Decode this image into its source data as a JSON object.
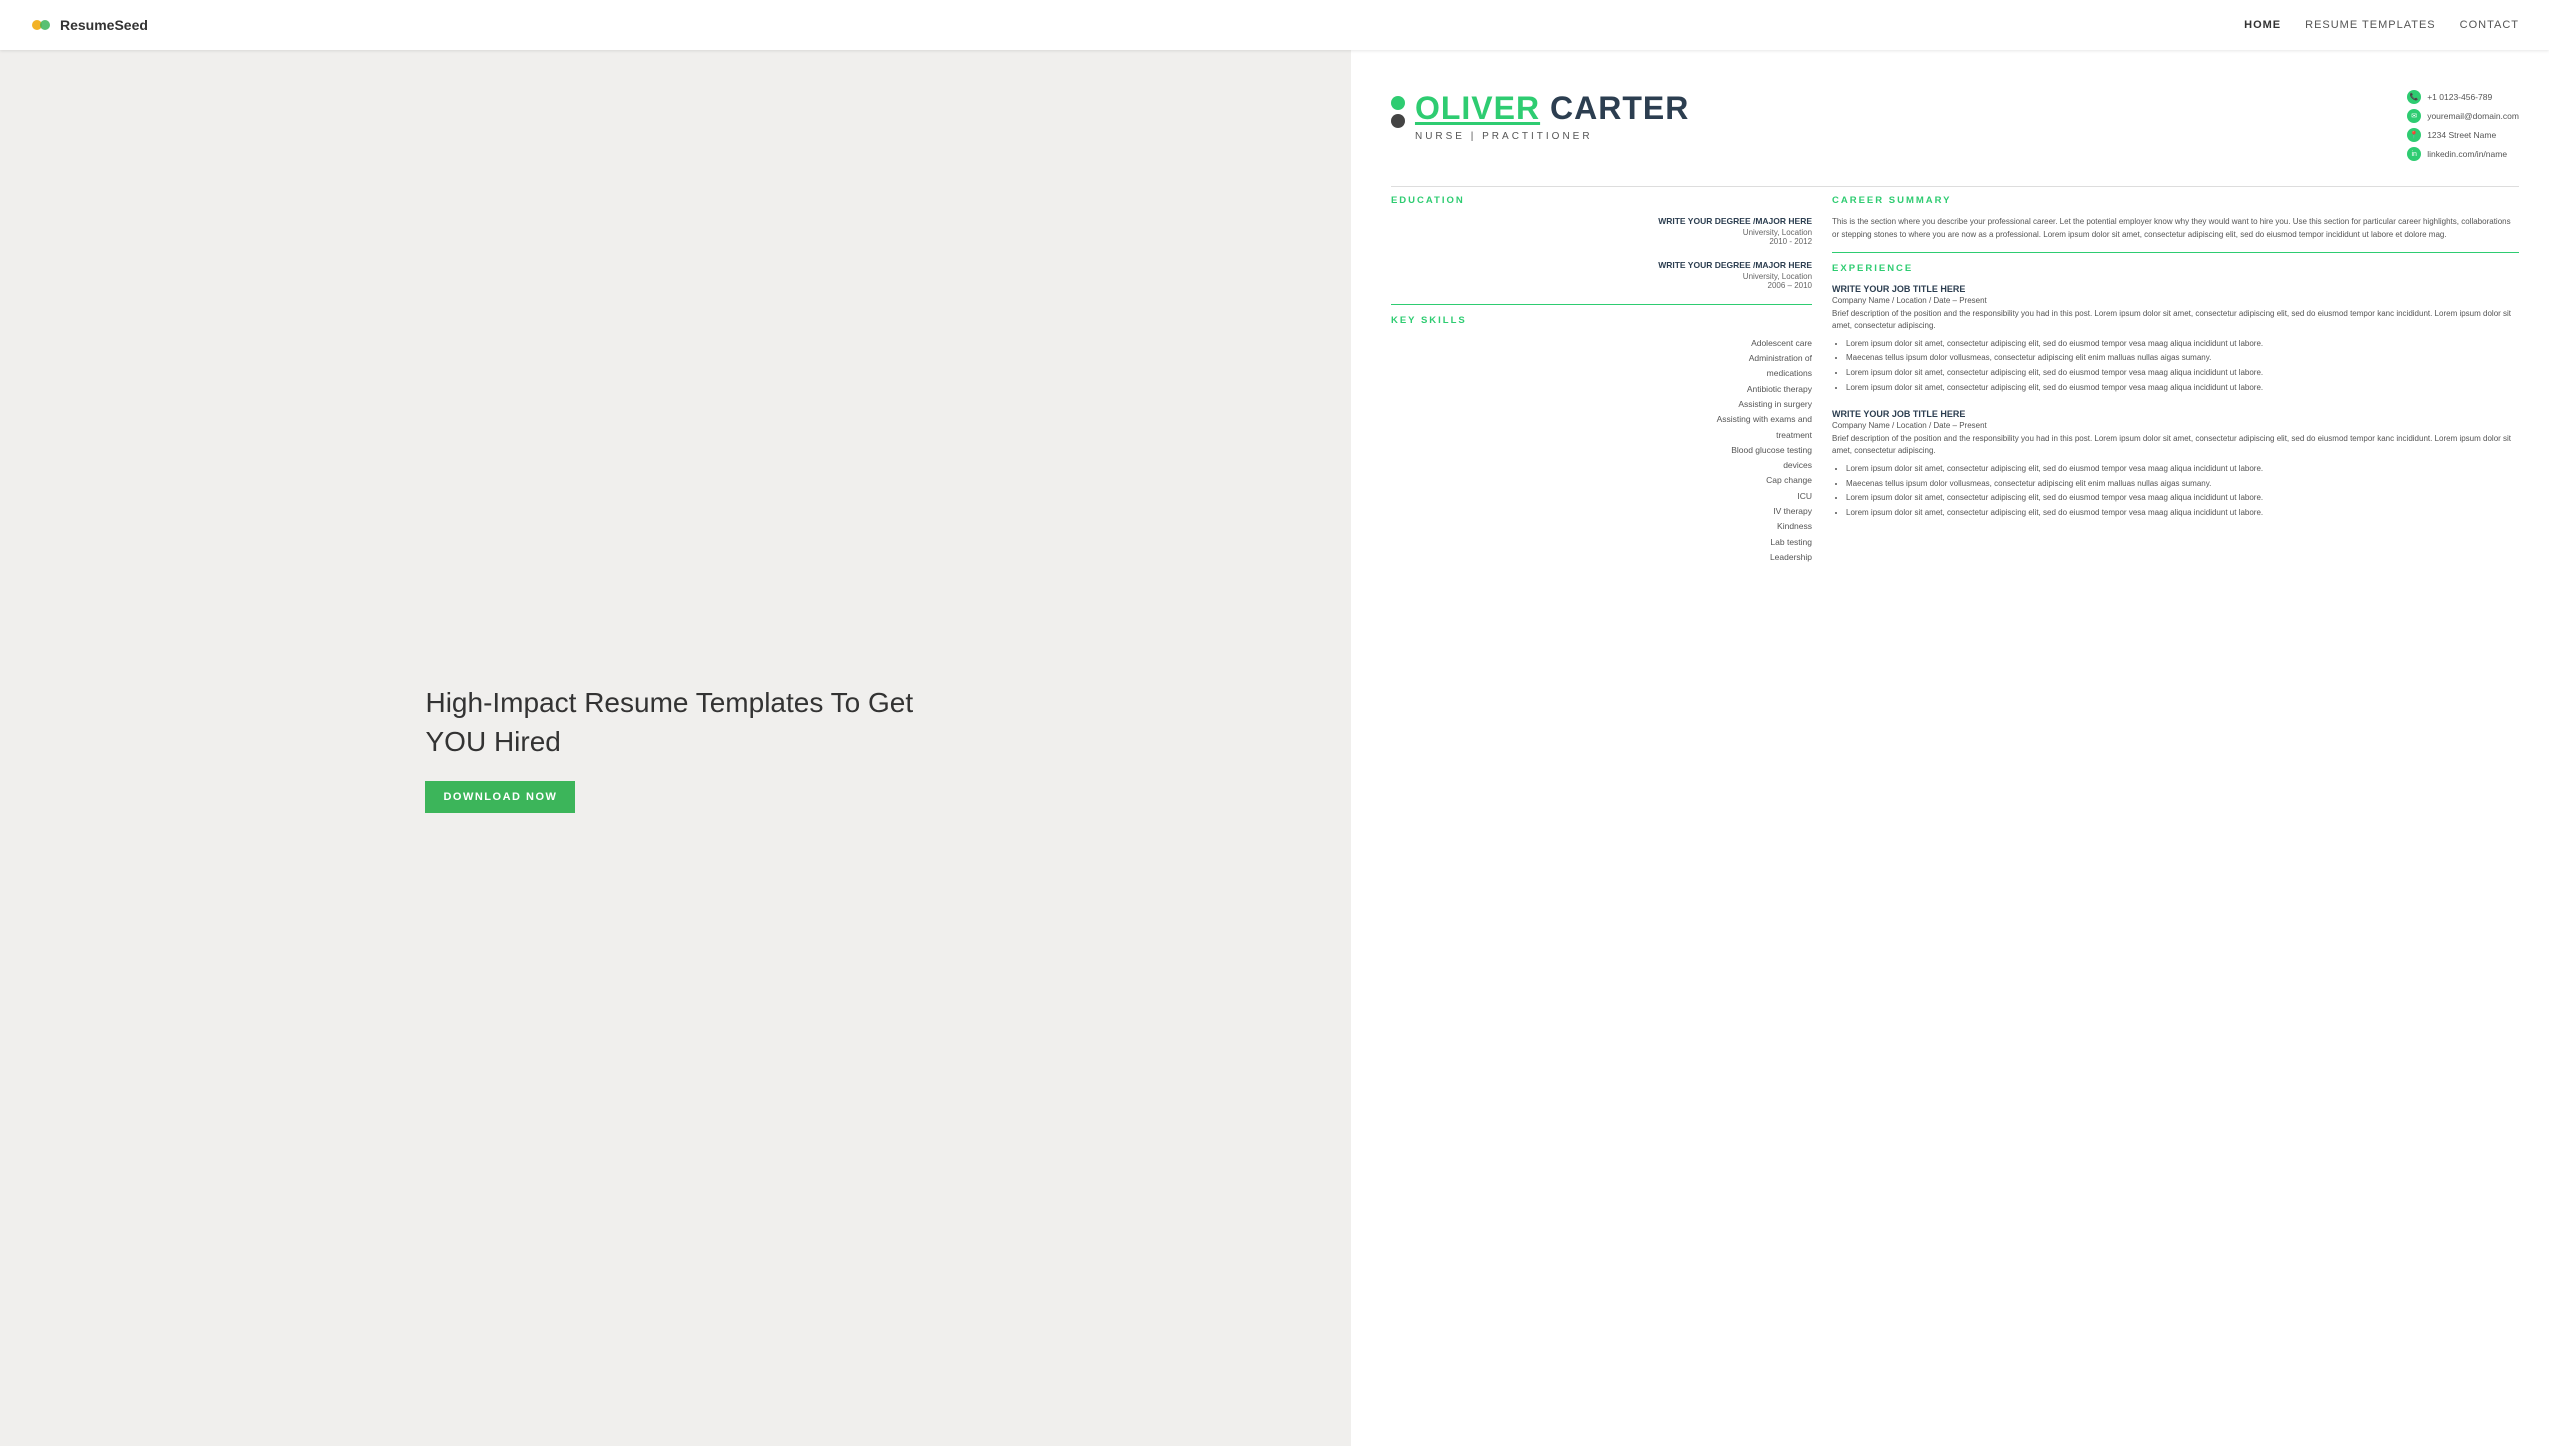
{
  "nav": {
    "logo_text": "ResumeSeed",
    "links": [
      {
        "label": "HOME",
        "active": true
      },
      {
        "label": "RESUME TEMPLATES",
        "active": false
      },
      {
        "label": "CONTACT",
        "active": false
      }
    ]
  },
  "hero": {
    "title": "High-Impact Resume Templates To Get YOU Hired",
    "download_label": "DOWNLOAD NOW"
  },
  "resume": {
    "first_name": "OLIVER",
    "last_name": "CARTER",
    "job_title": "NURSE | PRACTITIONER",
    "contact": {
      "phone": "+1 0123-456-789",
      "email": "youremail@domain.com",
      "address": "1234 Street Name",
      "linkedin": "linkedin.com/in/name"
    },
    "education_section_title": "EDUCATION",
    "education": [
      {
        "degree": "WRITE YOUR DEGREE /MAJOR HERE",
        "school": "University, Location",
        "years": "2010 - 2012"
      },
      {
        "degree": "WRITE YOUR DEGREE /MAJOR HERE",
        "school": "University, Location",
        "years": "2006 – 2010"
      }
    ],
    "skills_section_title": "KEY SKILLS",
    "skills": [
      "Adolescent care",
      "Administration of",
      "medications",
      "Antibiotic therapy",
      "Assisting in surgery",
      "Assisting with exams and",
      "treatment",
      "Blood glucose testing",
      "devices",
      "Cap change",
      "ICU",
      "IV therapy",
      "Kindness",
      "Lab testing",
      "Leadership"
    ],
    "career_summary_title": "CAREER SUMMARY",
    "career_summary": "This is the section where you describe your professional career. Let the potential employer know why they would want to hire you. Use this section for particular career highlights, collaborations or stepping stones to where you are now as a professional. Lorem ipsum dolor sit amet, consectetur adipiscing elit, sed do eiusmod tempor incididunt ut labore et dolore mag.",
    "experience_title": "EXPERIENCE",
    "experience": [
      {
        "job_title": "WRITE YOUR JOB TITLE HERE",
        "company": "Company Name / Location / Date – Present",
        "description": "Brief description of the position and the responsibility you had in this post. Lorem ipsum dolor sit amet, consectetur adipiscing elit, sed do eiusmod tempor kanc incididunt. Lorem ipsum dolor sit amet, consectetur adipiscing.",
        "bullets": [
          "Lorem ipsum dolor sit amet, consectetur adipiscing elit, sed do eiusmod tempor vesa maag aliqua incididunt ut labore.",
          "Maecenas tellus ipsum dolor vollusmeas, consectetur adipiscing elit enim malluas nullas aigas sumany.",
          "Lorem ipsum dolor sit amet, consectetur adipiscing elit, sed do eiusmod tempor vesa maag aliqua incididunt ut labore.",
          "Lorem ipsum dolor sit amet, consectetur adipiscing elit, sed do eiusmod tempor vesa maag aliqua incididunt ut labore."
        ]
      },
      {
        "job_title": "WRITE YOUR JOB TITLE HERE",
        "company": "Company Name / Location / Date – Present",
        "description": "Brief description of the position and the responsibility you had in this post. Lorem ipsum dolor sit amet, consectetur adipiscing elit, sed do eiusmod tempor kanc incididunt. Lorem ipsum dolor sit amet, consectetur adipiscing.",
        "bullets": [
          "Lorem ipsum dolor sit amet, consectetur adipiscing elit, sed do eiusmod tempor vesa maag aliqua incididunt ut labore.",
          "Maecenas tellus ipsum dolor vollusmeas, consectetur adipiscing elit enim malluas nullas aigas sumany.",
          "Lorem ipsum dolor sit amet, consectetur adipiscing elit, sed do eiusmod tempor vesa maag aliqua incididunt ut labore.",
          "Lorem ipsum dolor sit amet, consectetur adipiscing elit, sed do eiusmod tempor vesa maag aliqua incididunt ut labore."
        ]
      }
    ]
  },
  "colors": {
    "green": "#2ecc71",
    "dark": "#2c3e50",
    "bg": "#f0efed"
  }
}
